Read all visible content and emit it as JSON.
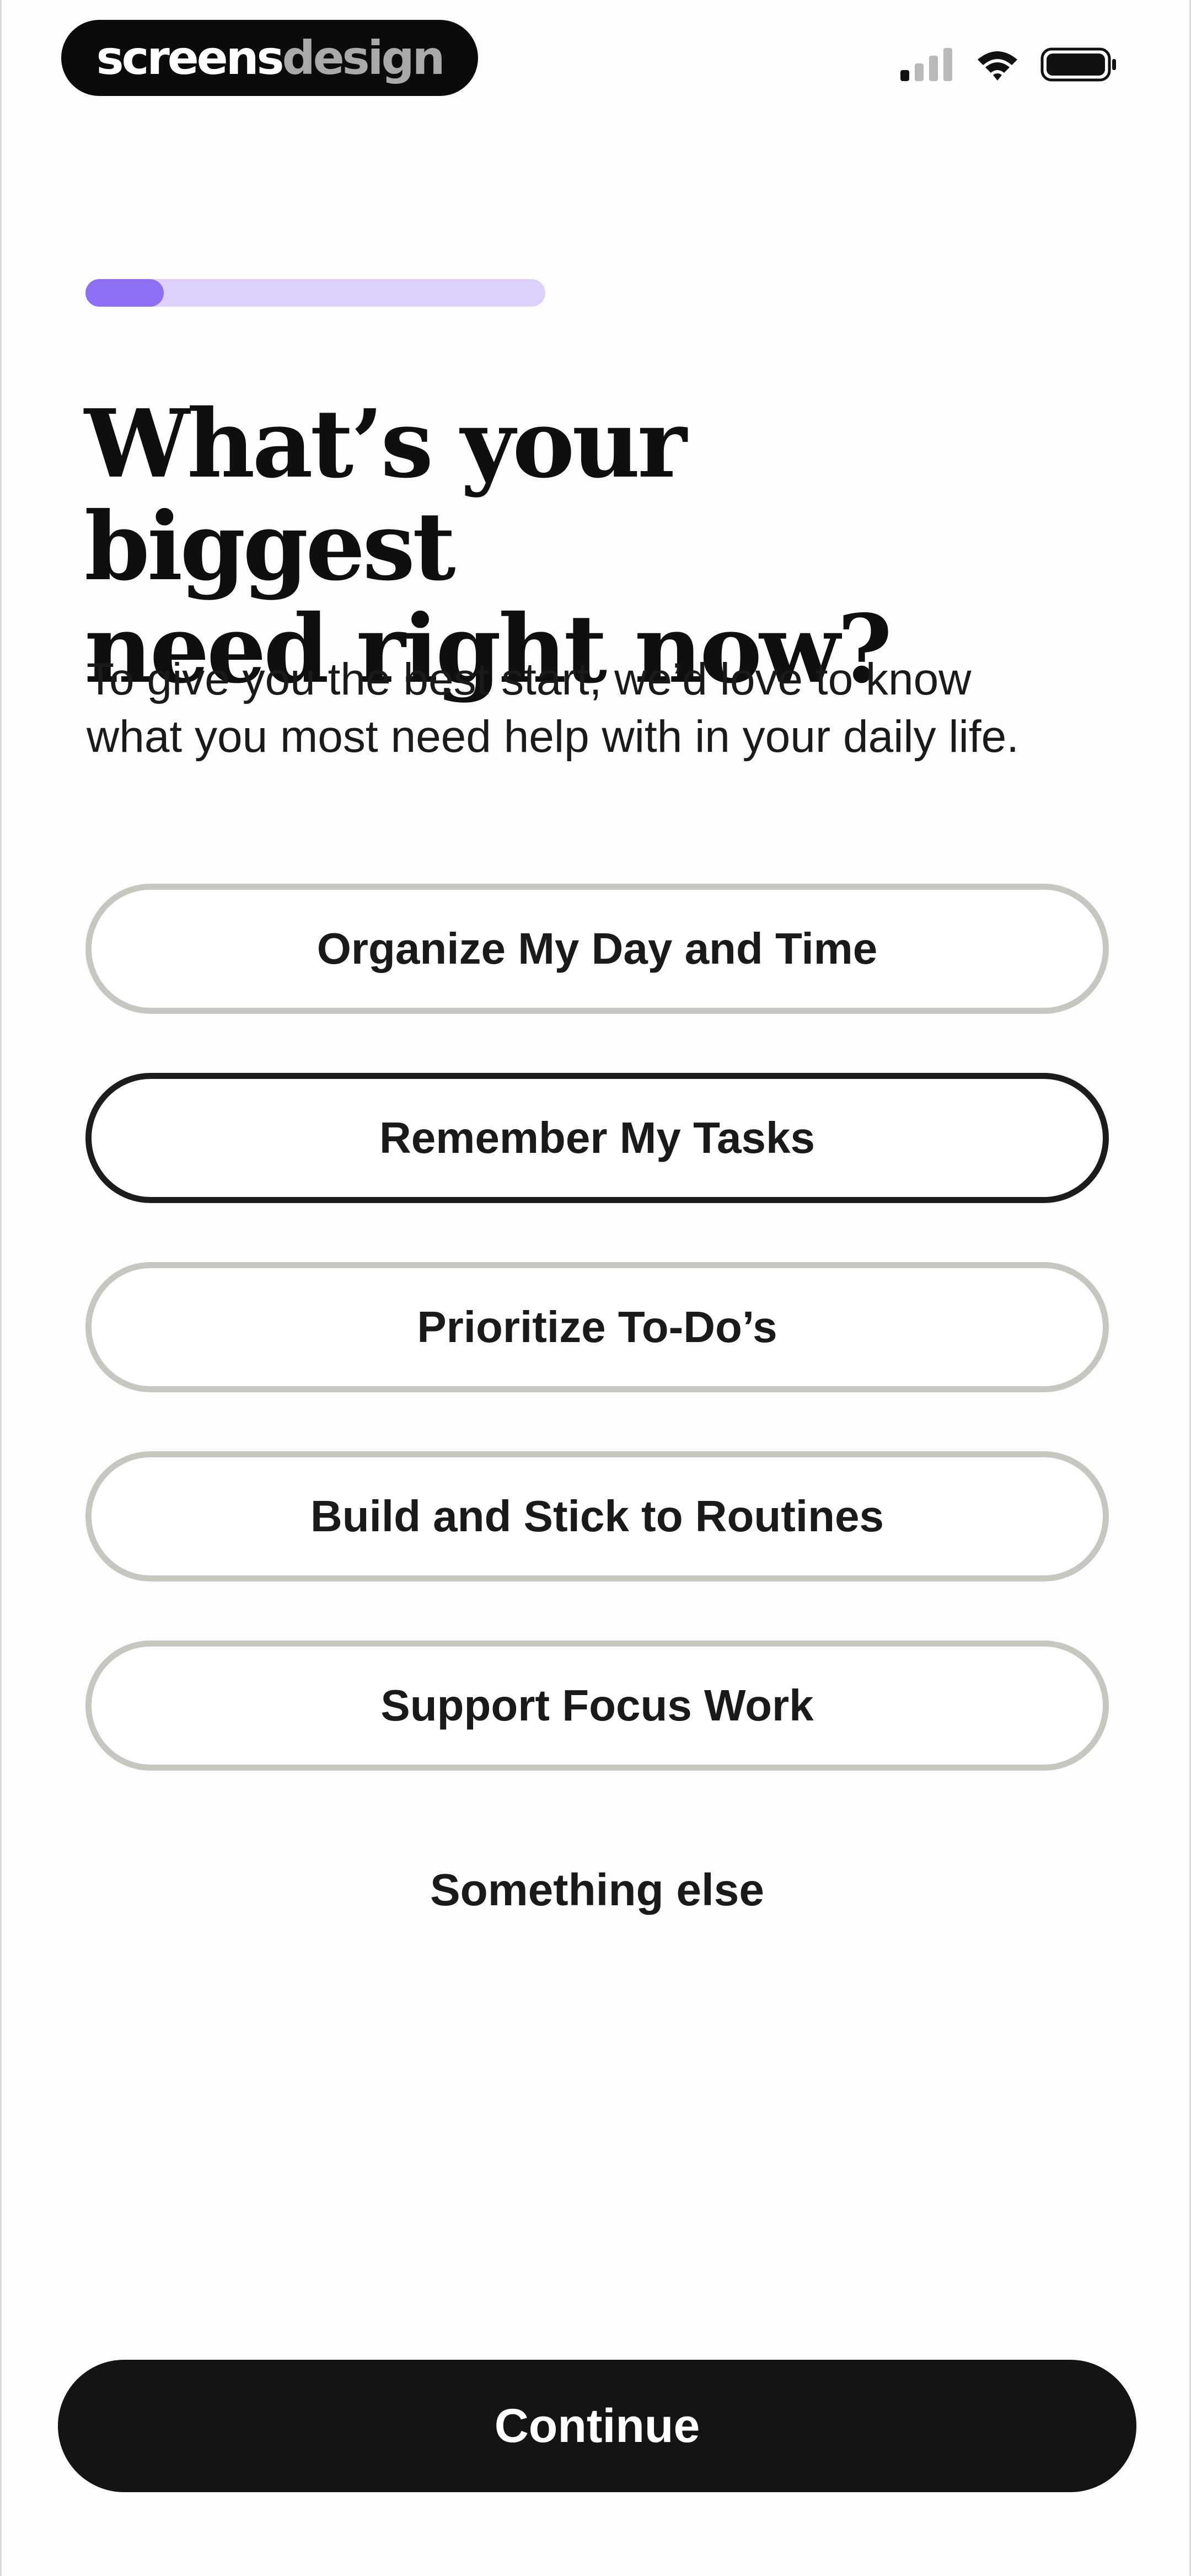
{
  "status_bar": {
    "brand_part1": "screens",
    "brand_part2": "design",
    "icons": [
      "cellular-signal-icon",
      "wifi-icon",
      "battery-icon"
    ]
  },
  "progress": {
    "fraction": 0.17
  },
  "header": {
    "title_line1": "What’s your biggest",
    "title_line2": "need right now?",
    "subtitle_line1": "To give you the best start, we’d love to know",
    "subtitle_line2": "what you most need help with in your daily life."
  },
  "options": [
    {
      "label": "Organize My Day and Time",
      "selected": false
    },
    {
      "label": "Remember My Tasks",
      "selected": true
    },
    {
      "label": "Prioritize To-Do’s",
      "selected": false
    },
    {
      "label": "Build and Stick to Routines",
      "selected": false
    },
    {
      "label": "Support Focus Work",
      "selected": false
    }
  ],
  "other_option": {
    "label": "Something else"
  },
  "footer": {
    "continue_label": "Continue"
  },
  "colors": {
    "progress_fill": "#8e6ef2",
    "progress_track": "#ddd1fb",
    "button_bg": "#141414",
    "option_border": "#c8c6c1",
    "option_border_selected": "#1c1c1c"
  }
}
